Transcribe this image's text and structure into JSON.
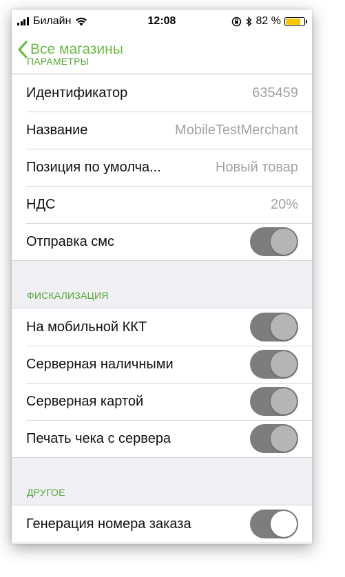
{
  "status_bar": {
    "carrier": "Билайн",
    "time": "12:08",
    "battery_text": "82 %",
    "battery_level": 0.82,
    "battery_color": "#f7c600",
    "icons": [
      "signal-icon",
      "wifi-icon",
      "rotation-lock-icon",
      "bluetooth-icon",
      "battery-icon"
    ]
  },
  "nav": {
    "back_label": "Все магазины",
    "accent_color": "#6cbd45"
  },
  "sections": {
    "params": {
      "header": "ПАРАМЕТРЫ",
      "rows": [
        {
          "label": "Идентификатор",
          "value": "635459"
        },
        {
          "label": "Название",
          "value": "MobileTestMerchant"
        },
        {
          "label": "Позиция по умолча...",
          "value": "Новый товар"
        },
        {
          "label": "НДС",
          "value": "20%"
        },
        {
          "label": "Отправка смс",
          "toggle": "on"
        }
      ]
    },
    "fiscal": {
      "header": "ФИСКАЛИЗАЦИЯ",
      "rows": [
        {
          "label": "На мобильной ККТ",
          "toggle": "on"
        },
        {
          "label": "Серверная наличными",
          "toggle": "on"
        },
        {
          "label": "Серверная картой",
          "toggle": "on"
        },
        {
          "label": "Печать чека с сервера",
          "toggle": "on"
        }
      ]
    },
    "other": {
      "header": "ДРУГОЕ",
      "rows": [
        {
          "label": "Генерация номера заказа",
          "toggle": "on"
        }
      ]
    }
  }
}
